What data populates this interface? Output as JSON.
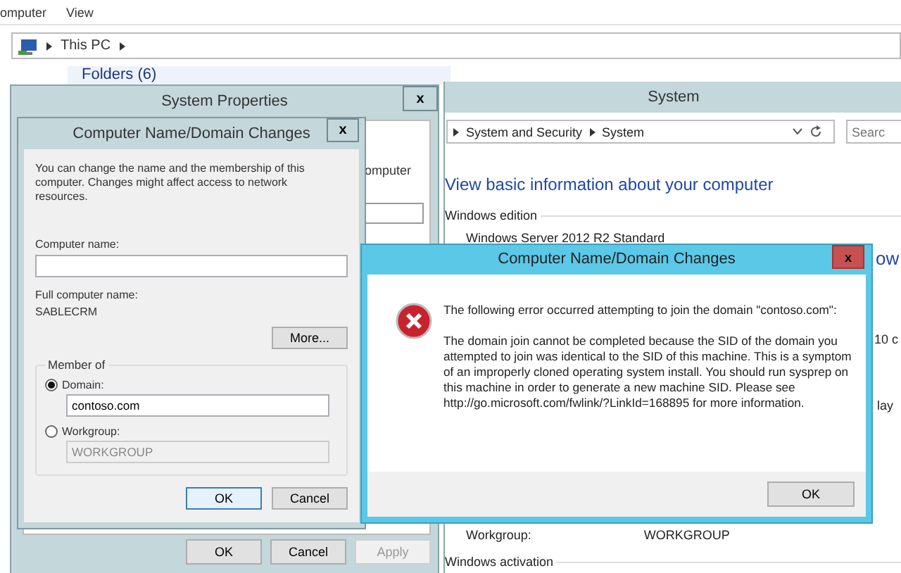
{
  "explorer": {
    "menu": [
      "omputer",
      "View"
    ],
    "address": [
      "This PC"
    ],
    "folders_header": "Folders (6)"
  },
  "system_window": {
    "title": "System",
    "breadcrumb": [
      "System and Security",
      "System"
    ],
    "search": {
      "placeholder": "Searc"
    },
    "heading": "View basic information about your computer",
    "section": "Windows edition",
    "edition": "Windows Server 2012 R2 Standard",
    "right_fragments": [
      "ow",
      "10 c",
      "lay"
    ],
    "workgroup_label": "Workgroup:",
    "workgroup_value": "WORKGROUP",
    "section_2": "Windows activation"
  },
  "system_properties": {
    "title": "System Properties",
    "close": "x",
    "panel_fragment": "omputer",
    "buttons": [
      {
        "label": "OK",
        "disabled": false
      },
      {
        "label": "Cancel",
        "disabled": false
      },
      {
        "label": "Apply",
        "disabled": true
      }
    ]
  },
  "name_dialog": {
    "title": "Computer Name/Domain Changes",
    "close": "x",
    "intro": "You can change the name and the membership of this computer. Changes might affect access to network resources.",
    "computer_name": {
      "label": "Computer name:"
    },
    "full_name_label": "Full computer name:",
    "full_name": "SABLECRM",
    "more_button": "More...",
    "member_of": {
      "title": "Member of",
      "options": [
        {
          "label": "Domain:",
          "selected": true,
          "value": "contoso.com"
        },
        {
          "label": "Workgroup:",
          "selected": false,
          "value": "WORKGROUP"
        }
      ]
    },
    "buttons": [
      {
        "label": "OK",
        "focused": true
      },
      {
        "label": "Cancel",
        "focused": false
      }
    ]
  },
  "error_dialog": {
    "title": "Computer Name/Domain Changes",
    "close": "x",
    "message": "The following error occurred attempting to join the domain \"contoso.com\":",
    "detail": "The domain join cannot be completed because the SID of the domain you attempted to join was identical to the SID of this machine. This is a symptom of an improperly cloned operating system install.  You should run sysprep on this machine in order to generate a new machine SID. Please see http://go.microsoft.com/fwlink/?LinkId=168895 for more information.",
    "buttons": [
      "OK"
    ]
  }
}
